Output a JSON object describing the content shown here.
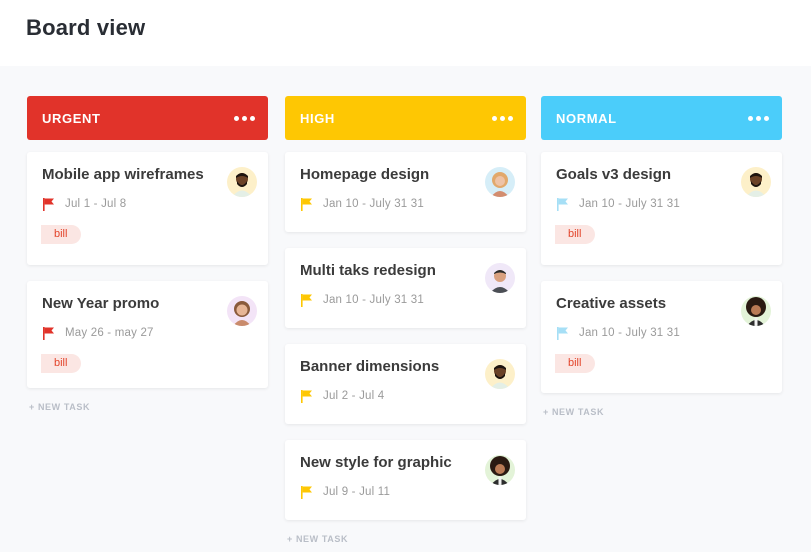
{
  "page": {
    "title": "Board view"
  },
  "colors": {
    "urgent": "#e1332a",
    "high": "#fec703",
    "normal": "#4bcdfa",
    "tag_bg": "#fbe6e3",
    "tag_text": "#e3452b"
  },
  "columns": [
    {
      "title": "URGENT",
      "menu_icon": "more-dots-icon",
      "new_task_label": "+ NEW TASK",
      "cards": [
        {
          "title": "Mobile app wireframes",
          "date": "Jul 1 - Jul 8",
          "flag": "red-flag-icon",
          "tag": "bill",
          "avatar": "avatar-man-beard"
        },
        {
          "title": "New Year promo",
          "date": "May 26 - may 27",
          "flag": "red-flag-icon",
          "tag": "bill",
          "avatar": "avatar-woman-curly"
        }
      ]
    },
    {
      "title": "HIGH",
      "menu_icon": "more-dots-icon",
      "new_task_label": "+ NEW TASK",
      "cards": [
        {
          "title": "Homepage design",
          "date": "Jan 10 - July 31 31",
          "flag": "yellow-flag-icon",
          "avatar": "avatar-woman-blonde"
        },
        {
          "title": "Multi taks redesign",
          "date": "Jan 10 - July 31 31",
          "flag": "yellow-flag-icon",
          "avatar": "avatar-man-smiling"
        },
        {
          "title": "Banner dimensions",
          "date": "Jul 2 - Jul 4",
          "flag": "yellow-flag-icon",
          "avatar": "avatar-man-beard"
        },
        {
          "title": "New style for graphic",
          "date": "Jul 9 - Jul 11",
          "flag": "yellow-flag-icon",
          "avatar": "avatar-man-afro"
        }
      ]
    },
    {
      "title": "NORMAL",
      "menu_icon": "more-dots-icon",
      "new_task_label": "+ NEW TASK",
      "cards": [
        {
          "title": "Goals v3 design",
          "date": "Jan 10 - July 31 31",
          "flag": "blue-flag-icon",
          "tag": "bill",
          "avatar": "avatar-man-beard"
        },
        {
          "title": "Creative assets",
          "date": "Jan 10 - July 31 31",
          "flag": "blue-flag-icon",
          "tag": "bill",
          "avatar": "avatar-man-afro"
        }
      ]
    }
  ]
}
